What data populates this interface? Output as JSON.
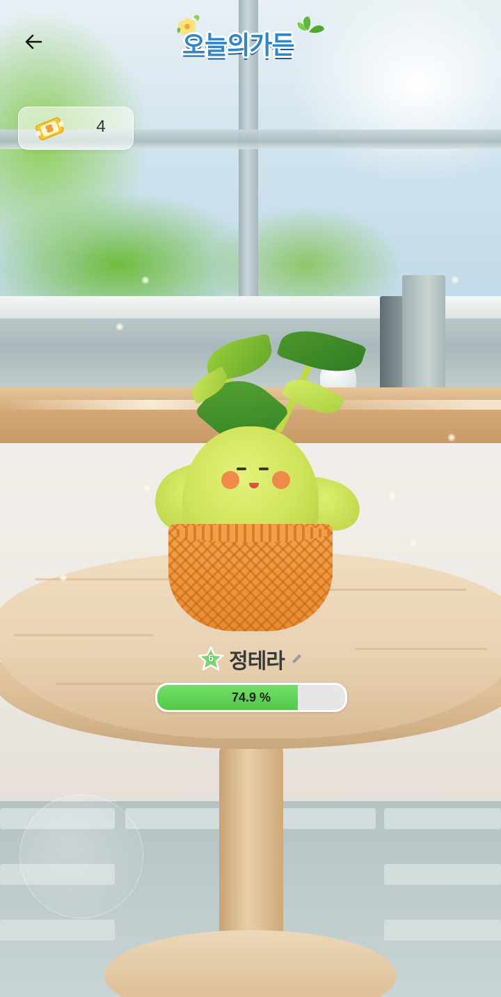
{
  "header": {
    "logo_text": "오늘의가든"
  },
  "tickets": {
    "count": "4",
    "icon": "clover-ticket-icon"
  },
  "plant": {
    "level": "6",
    "name": "정테라",
    "growth_label": "74.9 %",
    "growth_fraction": 0.749
  },
  "icons": {
    "back": "back-arrow-icon",
    "edit": "pencil-icon",
    "level": "star-badge-icon"
  },
  "colors": {
    "progress_fill": "#5ccf52",
    "progress_track": "#e6e6e6",
    "logo_blue": "#2f86c9",
    "ticket_yellow": "#f5c928"
  }
}
